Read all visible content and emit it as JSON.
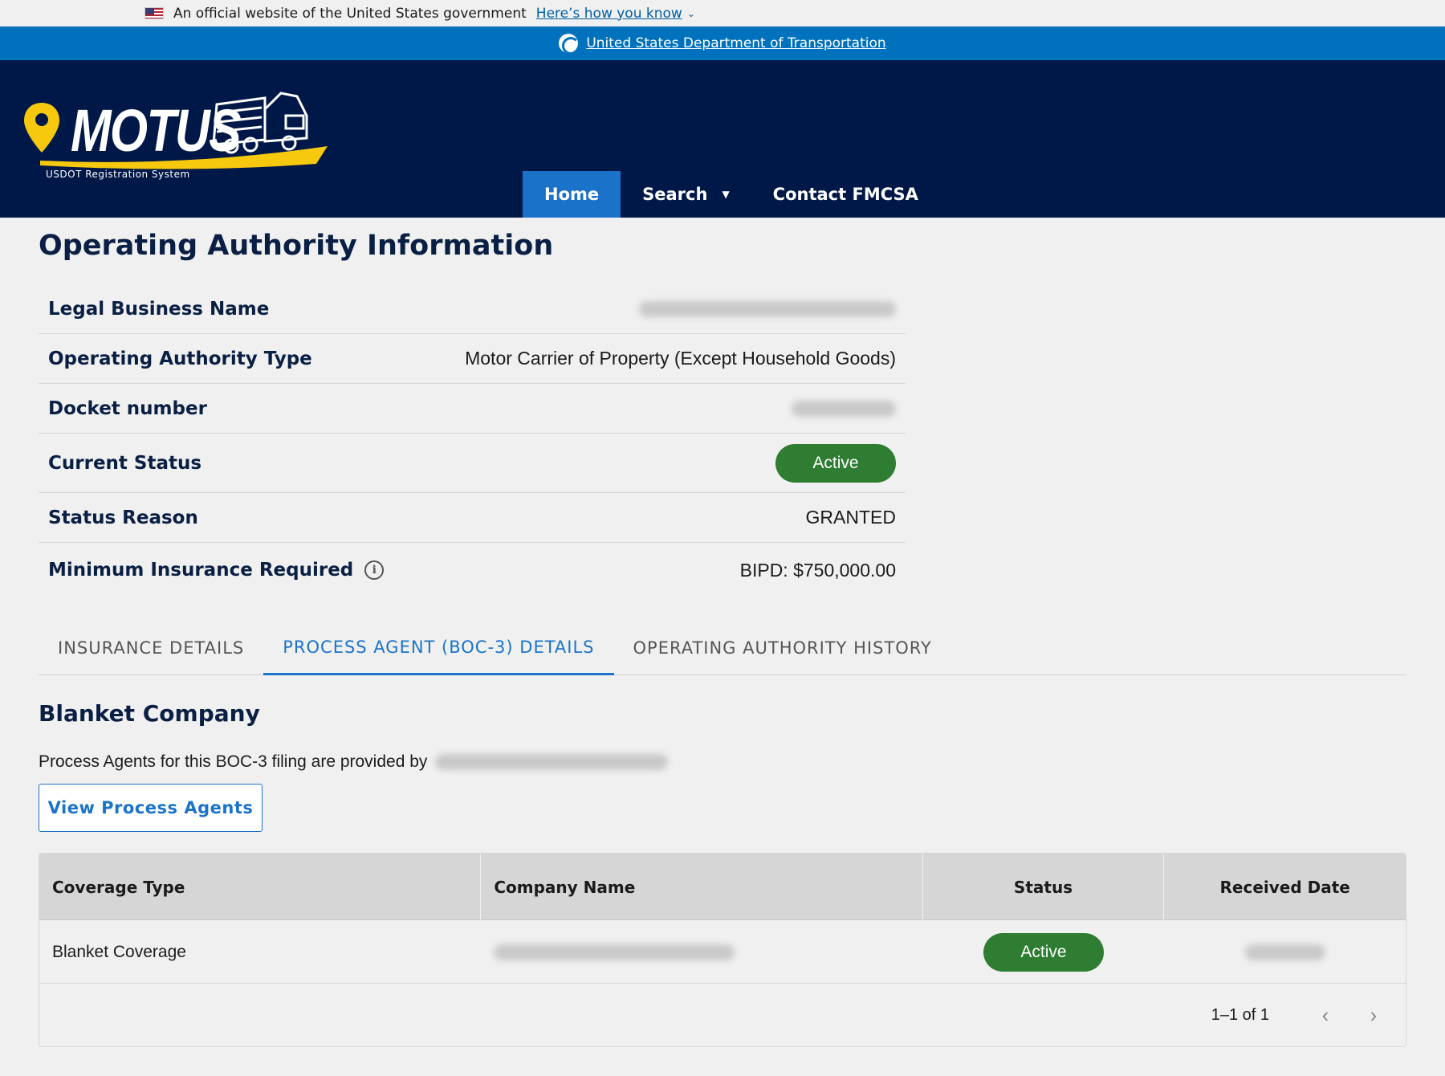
{
  "gov_banner": {
    "text": "An official website of the United States government",
    "link": "Here’s how you know"
  },
  "dot_bar": {
    "link": "United States Department of Transportation"
  },
  "logo": {
    "wordmark": "MOTUS",
    "subtitle": "USDOT Registration System"
  },
  "nav": {
    "home": "Home",
    "search": "Search",
    "contact": "Contact FMCSA"
  },
  "page": {
    "title": "Operating Authority Information"
  },
  "info": {
    "legal_name_label": "Legal Business Name",
    "type_label": "Operating Authority Type",
    "type_value": "Motor Carrier of Property (Except Household Goods)",
    "docket_label": "Docket number",
    "status_label": "Current Status",
    "status_value": "Active",
    "reason_label": "Status Reason",
    "reason_value": "GRANTED",
    "insurance_label": "Minimum Insurance Required",
    "insurance_value": "BIPD: $750,000.00"
  },
  "tabs": {
    "insurance": "INSURANCE DETAILS",
    "process_agent": "PROCESS AGENT (BOC-3) DETAILS",
    "history": "OPERATING AUTHORITY HISTORY"
  },
  "section": {
    "title": "Blanket Company",
    "text": "Process Agents for this BOC-3 filing are provided by",
    "button": "View Process Agents"
  },
  "grid": {
    "headers": {
      "coverage": "Coverage Type",
      "company": "Company Name",
      "status": "Status",
      "received": "Received Date"
    },
    "rows": [
      {
        "coverage": "Blanket Coverage",
        "status": "Active"
      }
    ],
    "pagination": "1–1 of 1"
  },
  "colors": {
    "header_bg": "#001847",
    "dot_bar_bg": "#0071bc",
    "accent": "#1a73c9",
    "status_active": "#2e7d32",
    "logo_pin": "#f6c90e"
  },
  "icons": {
    "flag": "us-flag-icon",
    "dot": "usdot-logo-icon",
    "info": "info-icon",
    "prev": "chevron-left-icon",
    "next": "chevron-right-icon"
  }
}
